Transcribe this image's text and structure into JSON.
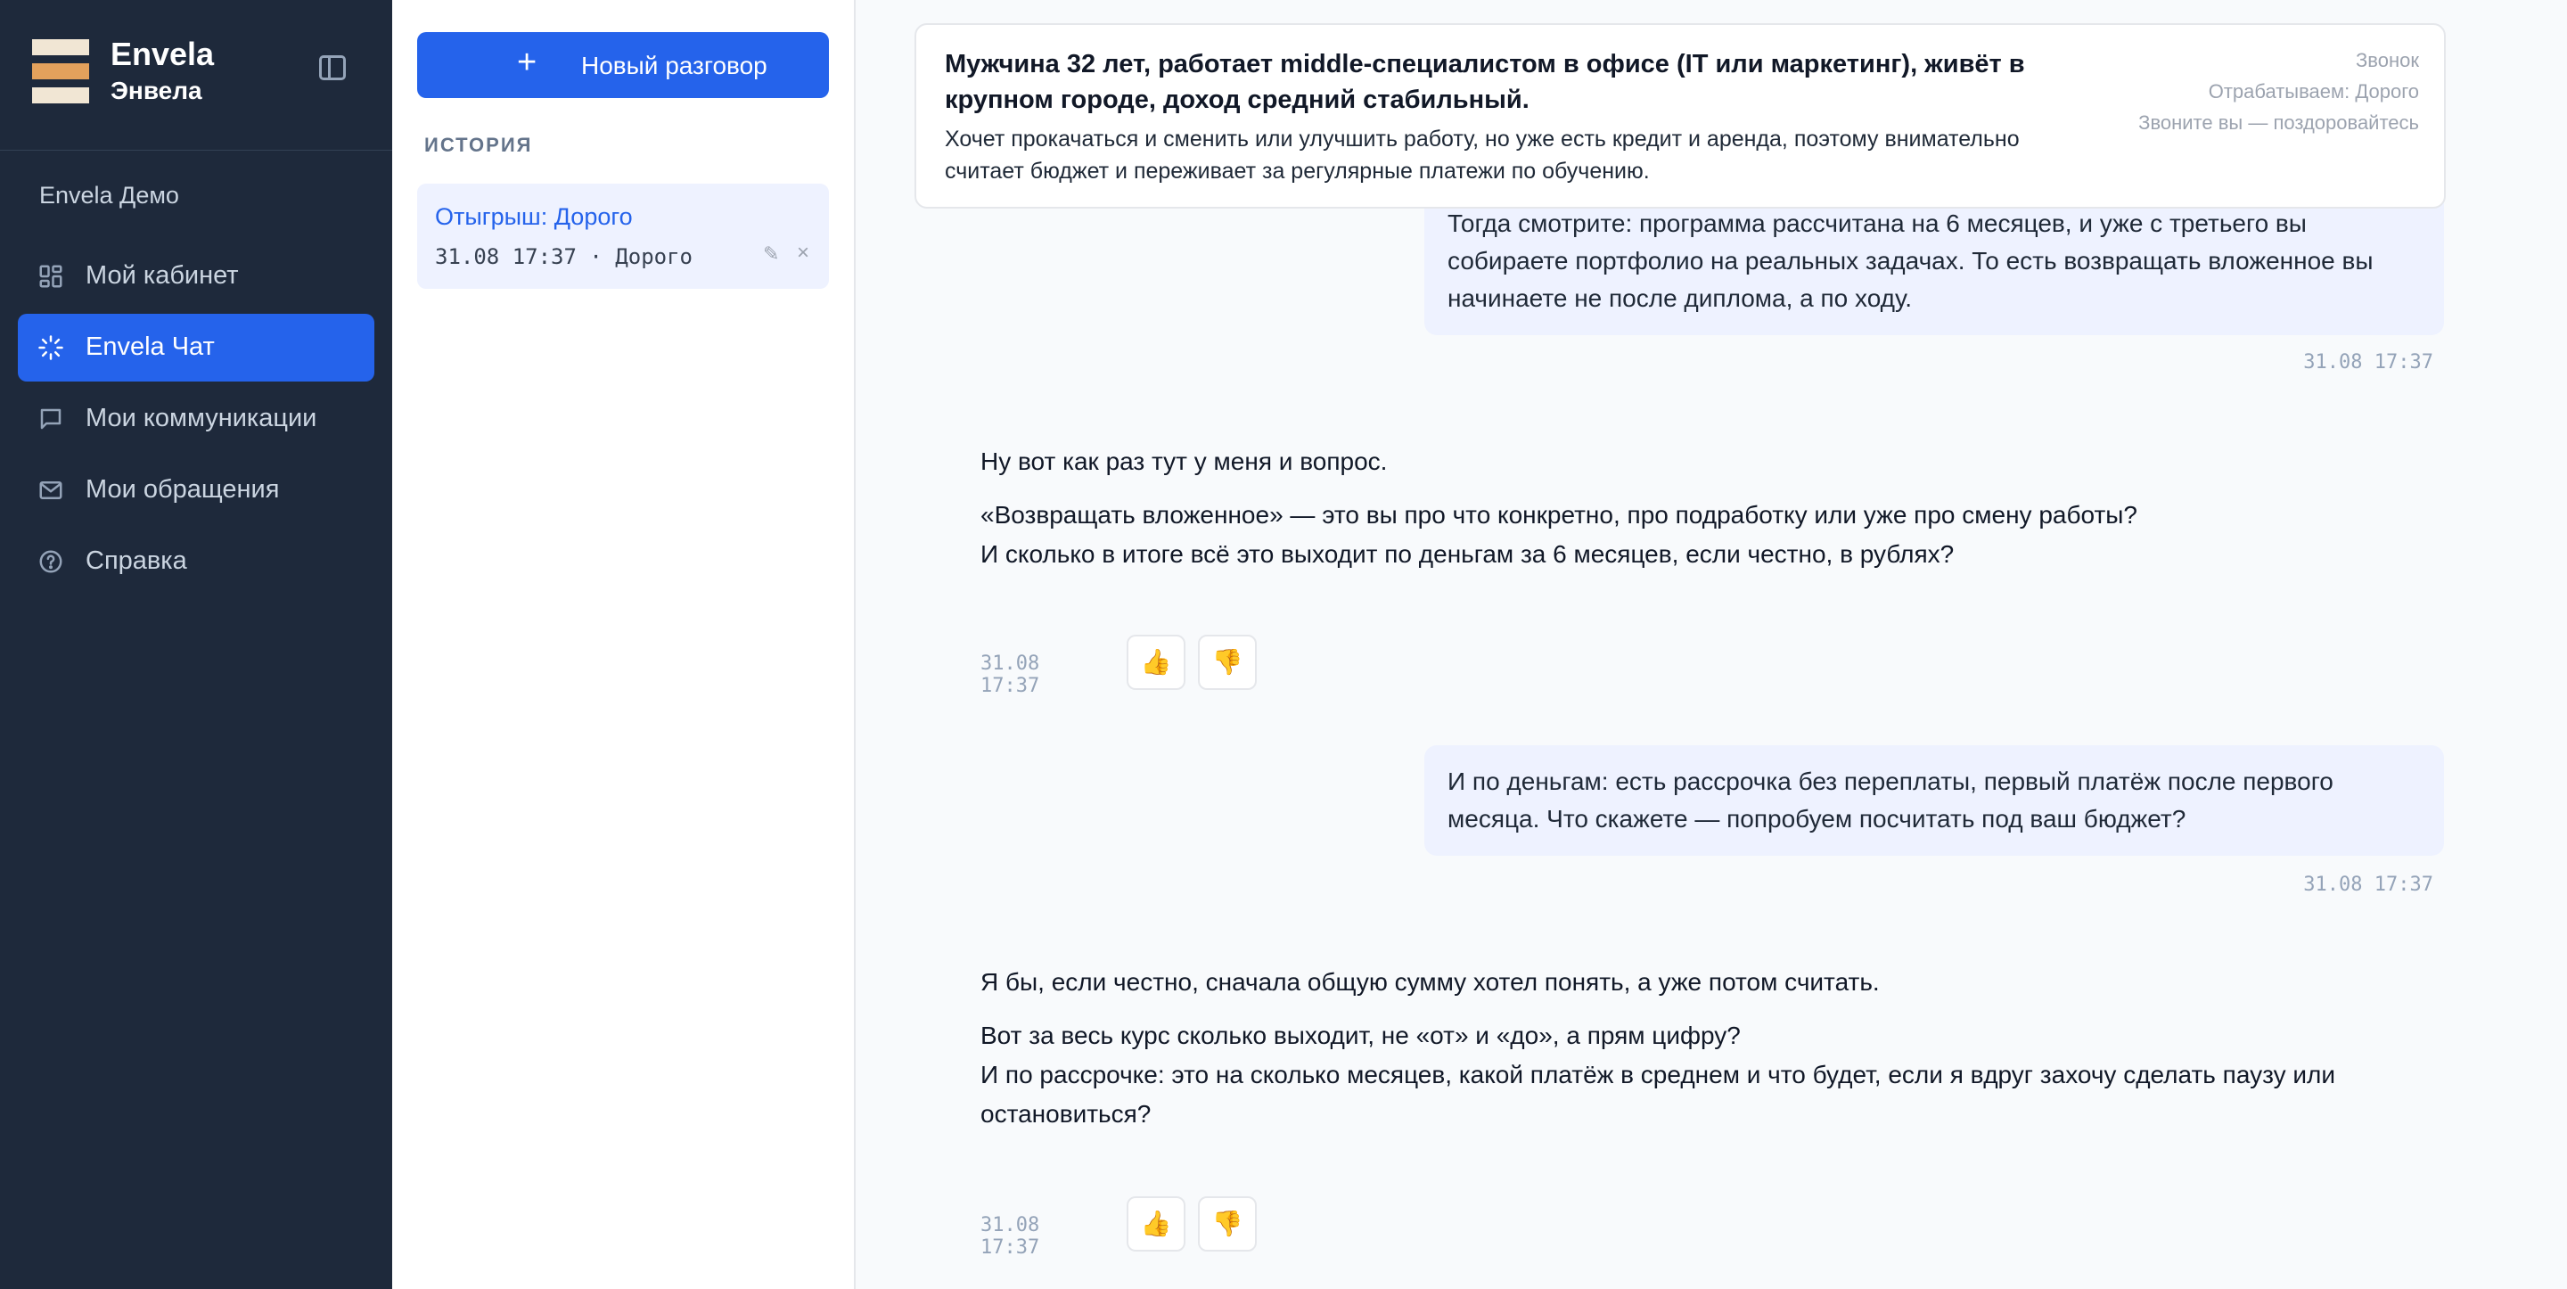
{
  "brand": {
    "name": "Envela",
    "subtitle": "Энвела",
    "logo_colors": [
      "#f1e6d4",
      "#e3a15c",
      "#f1e6d4"
    ]
  },
  "sidebar": {
    "workspace": "Envela Демо",
    "items": [
      {
        "label": "Мой кабинет",
        "icon": "dashboard-icon",
        "active": false
      },
      {
        "label": "Envela Чат",
        "icon": "loader-icon",
        "active": true
      },
      {
        "label": "Мои коммуникации",
        "icon": "chat-bubble-icon",
        "active": false
      },
      {
        "label": "Мои обращения",
        "icon": "mail-icon",
        "active": false
      },
      {
        "label": "Справка",
        "icon": "help-circle-icon",
        "active": false
      }
    ]
  },
  "history": {
    "new_button": "Новый разговор",
    "title": "ИСТОРИЯ",
    "conversations": [
      {
        "title": "Отыгрыш: Дорого",
        "meta": "31.08 17:37 · Дорого"
      }
    ]
  },
  "persona": {
    "title": "Мужчина 32 лет, работает middle-специалистом в офисе (IT или маркетинг), живёт в крупном городе, доход средний стабильный.",
    "description": "Хочет прокачаться и сменить или улучшить работу, но уже есть кредит и аренда, поэтому внимательно считает бюджет и переживает за регулярные платежи по обучению.",
    "meta": [
      "Звонок",
      "Отрабатываем: Дорого",
      "Звоните вы — поздоровайтесь"
    ]
  },
  "messages": [
    {
      "role": "user",
      "text": "Тогда смотрите: программа рассчитана на 6 месяцев, и уже с третьего вы собираете портфолио на реальных задачах. То есть возвращать вложенное вы начинаете не после диплома, а по ходу.",
      "time": "31.08 17:37"
    },
    {
      "role": "bot",
      "paragraphs": [
        "Ну вот как раз тут у меня и вопрос.",
        "«Возвращать вложенное» — это вы про что конкретно, про подработку или уже про смену работы?\nИ сколько в итоге всё это выходит по деньгам за 6 месяцев, если честно, в рублях?"
      ],
      "time": "31.08 17:37"
    },
    {
      "role": "user",
      "text": "И по деньгам: есть рассрочка без переплаты, первый платёж после первого месяца. Что скажете — попробуем посчитать под ваш бюджет?",
      "time": "31.08 17:37"
    },
    {
      "role": "bot",
      "paragraphs": [
        "Я бы, если честно, сначала общую сумму хотел понять, а уже потом считать.",
        "Вот за весь курс сколько выходит, не «от» и «до», а прям цифру?\nИ по рассрочке: это на сколько месяцев, какой платёж в среднем и что будет, если я вдруг захочу сделать паузу или остановиться?"
      ],
      "time": "31.08 17:37"
    }
  ],
  "colors": {
    "nav_bg": "#1e293b",
    "accent": "#2563eb",
    "user_bubble": "#eef2ff"
  }
}
